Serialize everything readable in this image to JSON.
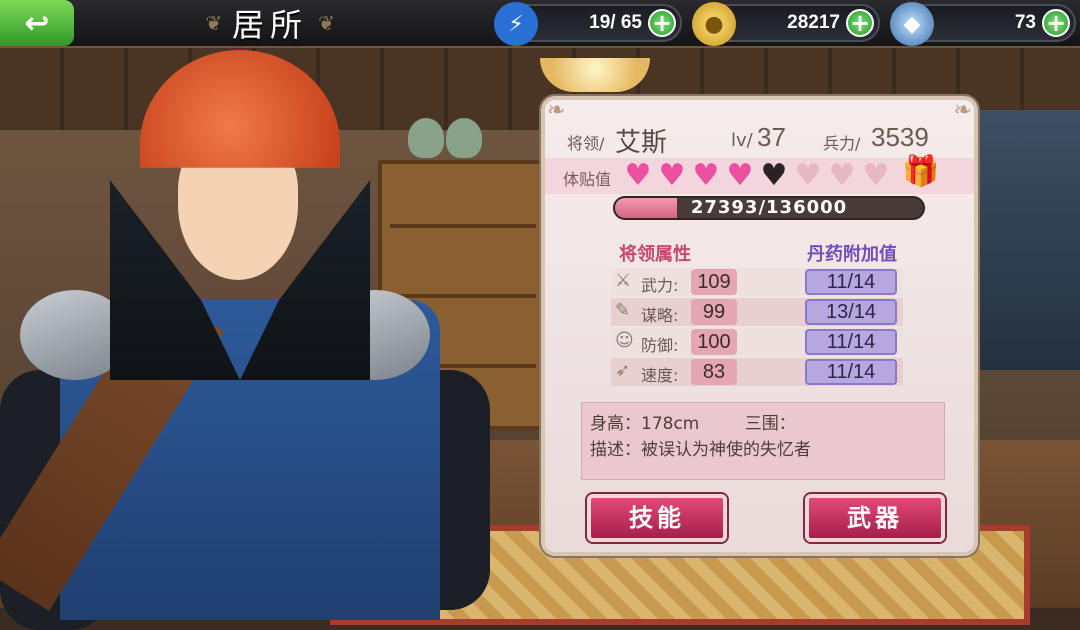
{
  "header": {
    "title": "居所",
    "back_icon": "back-arrow-icon"
  },
  "resources": [
    {
      "name": "stamina",
      "icon": "lightning-icon",
      "value": "19/ 65"
    },
    {
      "name": "gold",
      "icon": "coin-icon",
      "value": "28217"
    },
    {
      "name": "gem",
      "icon": "crystal-icon",
      "value": "73"
    }
  ],
  "general": {
    "name_label": "将领/",
    "name": "艾斯",
    "level_label": "lv/",
    "level": "37",
    "troops_label": "兵力/",
    "troops": "3539"
  },
  "affection": {
    "label": "体贴值",
    "hearts_filled": 4,
    "hearts_total": 8,
    "current": 27393,
    "max": 136000,
    "text": "27393/136000",
    "gift_icon": "gift-box-icon"
  },
  "attributes": {
    "left_header": "将领属性",
    "right_header": "丹药附加值",
    "rows": [
      {
        "icon": "sword-icon",
        "name": "武力:",
        "value": "109",
        "bonus": "11/14"
      },
      {
        "icon": "scroll-icon",
        "name": "谋略:",
        "value": "99",
        "bonus": "13/14"
      },
      {
        "icon": "mask-icon",
        "name": "防御:",
        "value": "100",
        "bonus": "11/14"
      },
      {
        "icon": "boot-icon",
        "name": "速度:",
        "value": "83",
        "bonus": "11/14"
      }
    ]
  },
  "profile": {
    "height_label": "身高：",
    "height": "178cm",
    "measurements_label": "三围：",
    "desc_label": "描述：",
    "desc": "被误认为神使的失忆者"
  },
  "buttons": {
    "skills": "技能",
    "weapon": "武器"
  },
  "colors": {
    "accent_pink": "#d56381",
    "button_red": "#c7305e",
    "bonus_purple": "#b7a7e0"
  }
}
